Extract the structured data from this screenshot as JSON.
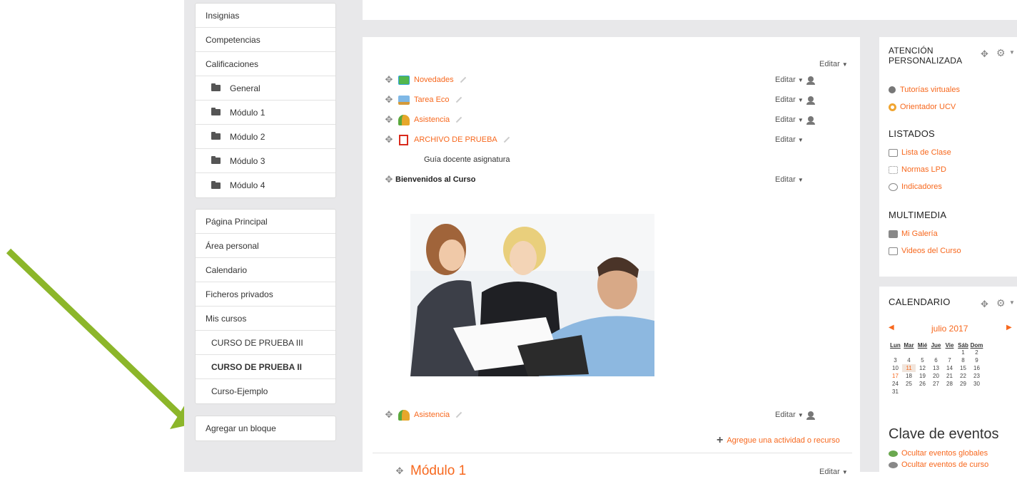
{
  "nav_top": [
    "Insignias",
    "Competencias",
    "Calificaciones"
  ],
  "nav_modules": [
    "General",
    "Módulo 1",
    "Módulo 2",
    "Módulo 3",
    "Módulo 4"
  ],
  "nav_main": [
    "Página Principal",
    "Área personal",
    "Calendario",
    "Ficheros privados",
    "Mis cursos"
  ],
  "nav_courses": [
    "CURSO DE PRUEBA III",
    "CURSO DE PRUEBA II",
    "Curso-Ejemplo"
  ],
  "add_block": "Agregar un bloque",
  "edit_label": "Editar",
  "activities": [
    {
      "name": "Novedades",
      "icon": "forum-icon"
    },
    {
      "name": "Tarea Eco",
      "icon": "assignment-icon"
    },
    {
      "name": "Asistencia",
      "icon": "attendance-icon"
    },
    {
      "name": "ARCHIVO DE PRUEBA",
      "icon": "pdf-icon"
    }
  ],
  "guide_text": "Guía docente asignatura",
  "welcome_label": "Bienvenidos al Curso",
  "bottom_activity": "Asistencia",
  "add_activity": "Agregue una actividad o recurso",
  "next_section": "Módulo 1",
  "blocks": {
    "atencion": {
      "title_line1": "ATENCIÓN",
      "title_line2": "PERSONALIZADA",
      "links": [
        "Tutorías virtuales",
        "Orientador UCV"
      ]
    },
    "listados": {
      "title": "LISTADOS",
      "links": [
        "Lista de Clase",
        "Normas LPD",
        "Indicadores"
      ]
    },
    "multimedia": {
      "title": "MULTIMEDIA",
      "links": [
        "Mi Galería",
        "Videos del Curso"
      ]
    }
  },
  "calendar": {
    "title": "CALENDARIO",
    "month": "julio 2017",
    "weekdays": [
      "Lun",
      "Mar",
      "Mié",
      "Jue",
      "Vie",
      "Sáb",
      "Dom"
    ],
    "weeks": [
      [
        "",
        "",
        "",
        "",
        "",
        "1",
        "2"
      ],
      [
        "3",
        "4",
        "5",
        "6",
        "7",
        "8",
        "9"
      ],
      [
        "10",
        "11",
        "12",
        "13",
        "14",
        "15",
        "16"
      ],
      [
        "17",
        "18",
        "19",
        "20",
        "21",
        "22",
        "23"
      ],
      [
        "24",
        "25",
        "26",
        "27",
        "28",
        "29",
        "30"
      ],
      [
        "31",
        "",
        "",
        "",
        "",
        "",
        ""
      ]
    ],
    "today": "11",
    "event_day": "17",
    "events_key_title": "Clave de eventos",
    "events_key_links": [
      "Ocultar eventos globales",
      "Ocultar eventos de curso"
    ]
  },
  "colors": {
    "accent": "#f7681e",
    "annotation_arrow": "#8cb62a"
  }
}
